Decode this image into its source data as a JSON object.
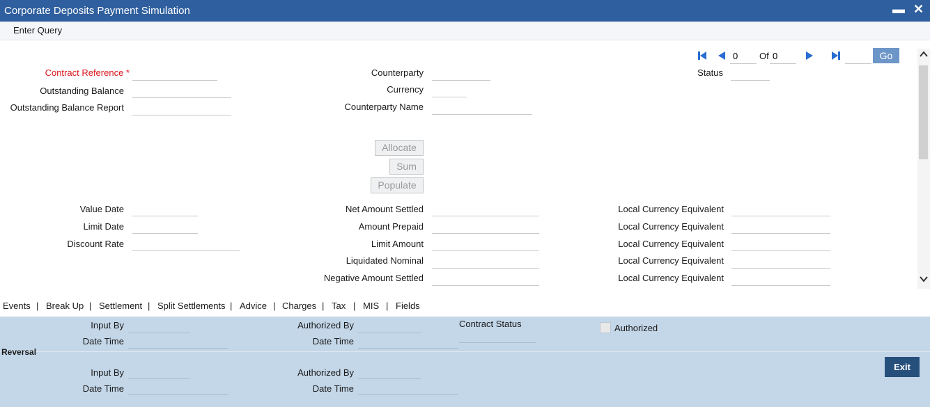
{
  "window": {
    "title": "Corporate Deposits Payment Simulation",
    "minimize": "▬",
    "close": "✕"
  },
  "toolbar": {
    "enter_query": "Enter Query"
  },
  "navigation": {
    "current": "0",
    "of_label": "Of",
    "total": "0",
    "go_label": "Go",
    "first_icon": "first-page-icon",
    "prev_icon": "prev-page-icon",
    "next_icon": "next-page-icon",
    "last_icon": "last-page-icon"
  },
  "header": {
    "contract_reference": "Contract Reference",
    "required_marker": "*",
    "outstanding_balance": "Outstanding Balance",
    "outstanding_balance_report": "Outstanding Balance Report",
    "counterparty": "Counterparty",
    "currency": "Currency",
    "counterparty_name": "Counterparty Name",
    "status": "Status"
  },
  "actions": {
    "allocate": "Allocate",
    "sum": "Sum",
    "populate": "Populate"
  },
  "details": {
    "value_date": "Value Date",
    "limit_date": "Limit Date",
    "discount_rate": "Discount Rate",
    "net_amount_settled": "Net Amount Settled",
    "amount_prepaid": "Amount Prepaid",
    "limit_amount": "Limit Amount",
    "liquidated_nominal": "Liquidated Nominal",
    "negative_amount_settled": "Negative Amount Settled",
    "local_currency_equivalent": "Local Currency Equivalent"
  },
  "tabs": [
    "Events",
    "Break Up",
    "Settlement",
    "Split Settlements",
    "Advice",
    "Charges",
    "Tax",
    "MIS",
    "Fields"
  ],
  "tab_separator": "|",
  "audit": {
    "input_by": "Input By",
    "date_time": "Date Time",
    "authorized_by": "Authorized By",
    "contract_status": "Contract Status",
    "authorized": "Authorized",
    "reversal": "Reversal",
    "exit": "Exit"
  }
}
